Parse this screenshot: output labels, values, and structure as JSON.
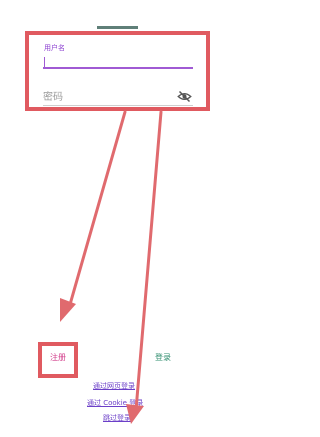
{
  "form": {
    "username_label": "用户名",
    "username_value": "",
    "password_placeholder": "密码"
  },
  "icons": {
    "password_toggle": "eye-off-icon"
  },
  "actions": {
    "register_label": "注册",
    "login_label": "登录"
  },
  "links": {
    "web_login": "通过网页登录",
    "cookie_login": "通过 Cookie 登录",
    "skip_login": "跳过登录"
  },
  "colors": {
    "accent": "#a05ad4",
    "highlight": "#e05a60",
    "register": "#d23c8a",
    "login": "#2e8c6d"
  }
}
